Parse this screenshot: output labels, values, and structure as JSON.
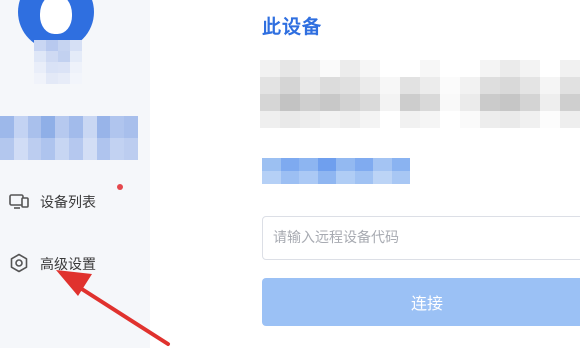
{
  "sidebar": {
    "avatar_icon": "user-avatar-icon",
    "items": [
      {
        "label": "设备列表",
        "icon": "device-list-icon",
        "has_notification_dot": true
      },
      {
        "label": "高级设置",
        "icon": "settings-hexagon-icon"
      }
    ]
  },
  "main": {
    "title": "此设备",
    "code_input": {
      "placeholder": "请输入远程设备代码",
      "value": ""
    },
    "connect_label": "连接"
  },
  "colors": {
    "accent": "#2f6fe0",
    "button_disabled": "#9bc1f5",
    "annotation_arrow": "#e0322e",
    "notification_dot": "#e5484d"
  }
}
